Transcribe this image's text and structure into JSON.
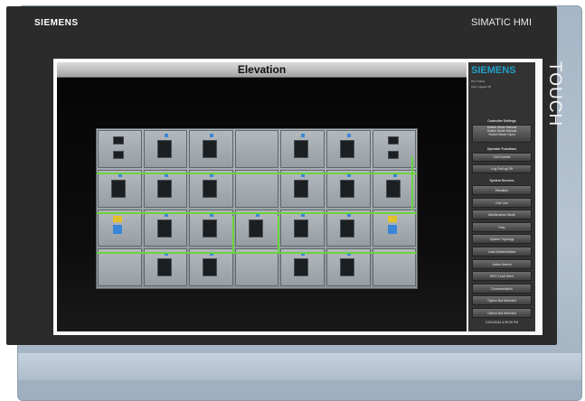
{
  "bezel": {
    "brand": "SIEMENS",
    "model": "SIMATIC HMI",
    "side_text": "TOUCH"
  },
  "screen": {
    "title": "Elevation",
    "sidebar": {
      "logo": "SIEMENS",
      "line1": "PLC Online",
      "line2": "User Logged Off",
      "section_controller": "Controller Settings",
      "controller_modes": [
        "Switch Mode Manual",
        "Switch Mode Manual",
        "Switch Mode Open"
      ],
      "section_operator": "Operator Functions",
      "operator_buttons": [
        "Cell Number",
        "Log On/Log Off"
      ],
      "section_system": "System Screens",
      "system_buttons": [
        "Elevation",
        "One Line",
        "Maintenance Mode",
        "Help",
        "System Topology",
        "Load Administrative",
        "Active Alarms",
        "MCC Load Shed",
        "Documentation",
        "Option Not Selected",
        "Option Not Selected"
      ],
      "datetime": "10/21/2024 4:39:39 PM"
    }
  }
}
